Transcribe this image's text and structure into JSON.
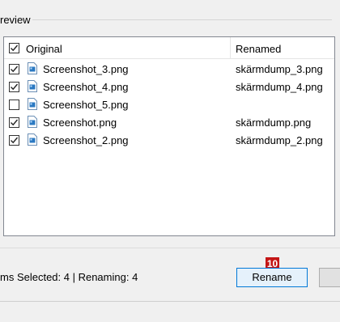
{
  "preview_group": {
    "title": "review"
  },
  "list": {
    "header": {
      "original": "Original",
      "renamed": "Renamed",
      "checked": true
    },
    "rows": [
      {
        "original": "Screenshot_3.png",
        "renamed": "skärmdump_3.png",
        "checked": true
      },
      {
        "original": "Screenshot_4.png",
        "renamed": "skärmdump_4.png",
        "checked": true
      },
      {
        "original": "Screenshot_5.png",
        "renamed": "",
        "checked": false
      },
      {
        "original": "Screenshot.png",
        "renamed": "skärmdump.png",
        "checked": true
      },
      {
        "original": "Screenshot_2.png",
        "renamed": "skärmdump_2.png",
        "checked": true
      }
    ]
  },
  "status": {
    "text": "ms Selected: 4 | Renaming: 4"
  },
  "buttons": {
    "rename_label": "Rename",
    "badge": "10"
  },
  "colors": {
    "accent": "#0078d7",
    "badge": "#c41616",
    "file_icon": "#2b79c2"
  },
  "icons": {
    "checkbox": "checkmark-icon",
    "file": "image-file-icon"
  }
}
